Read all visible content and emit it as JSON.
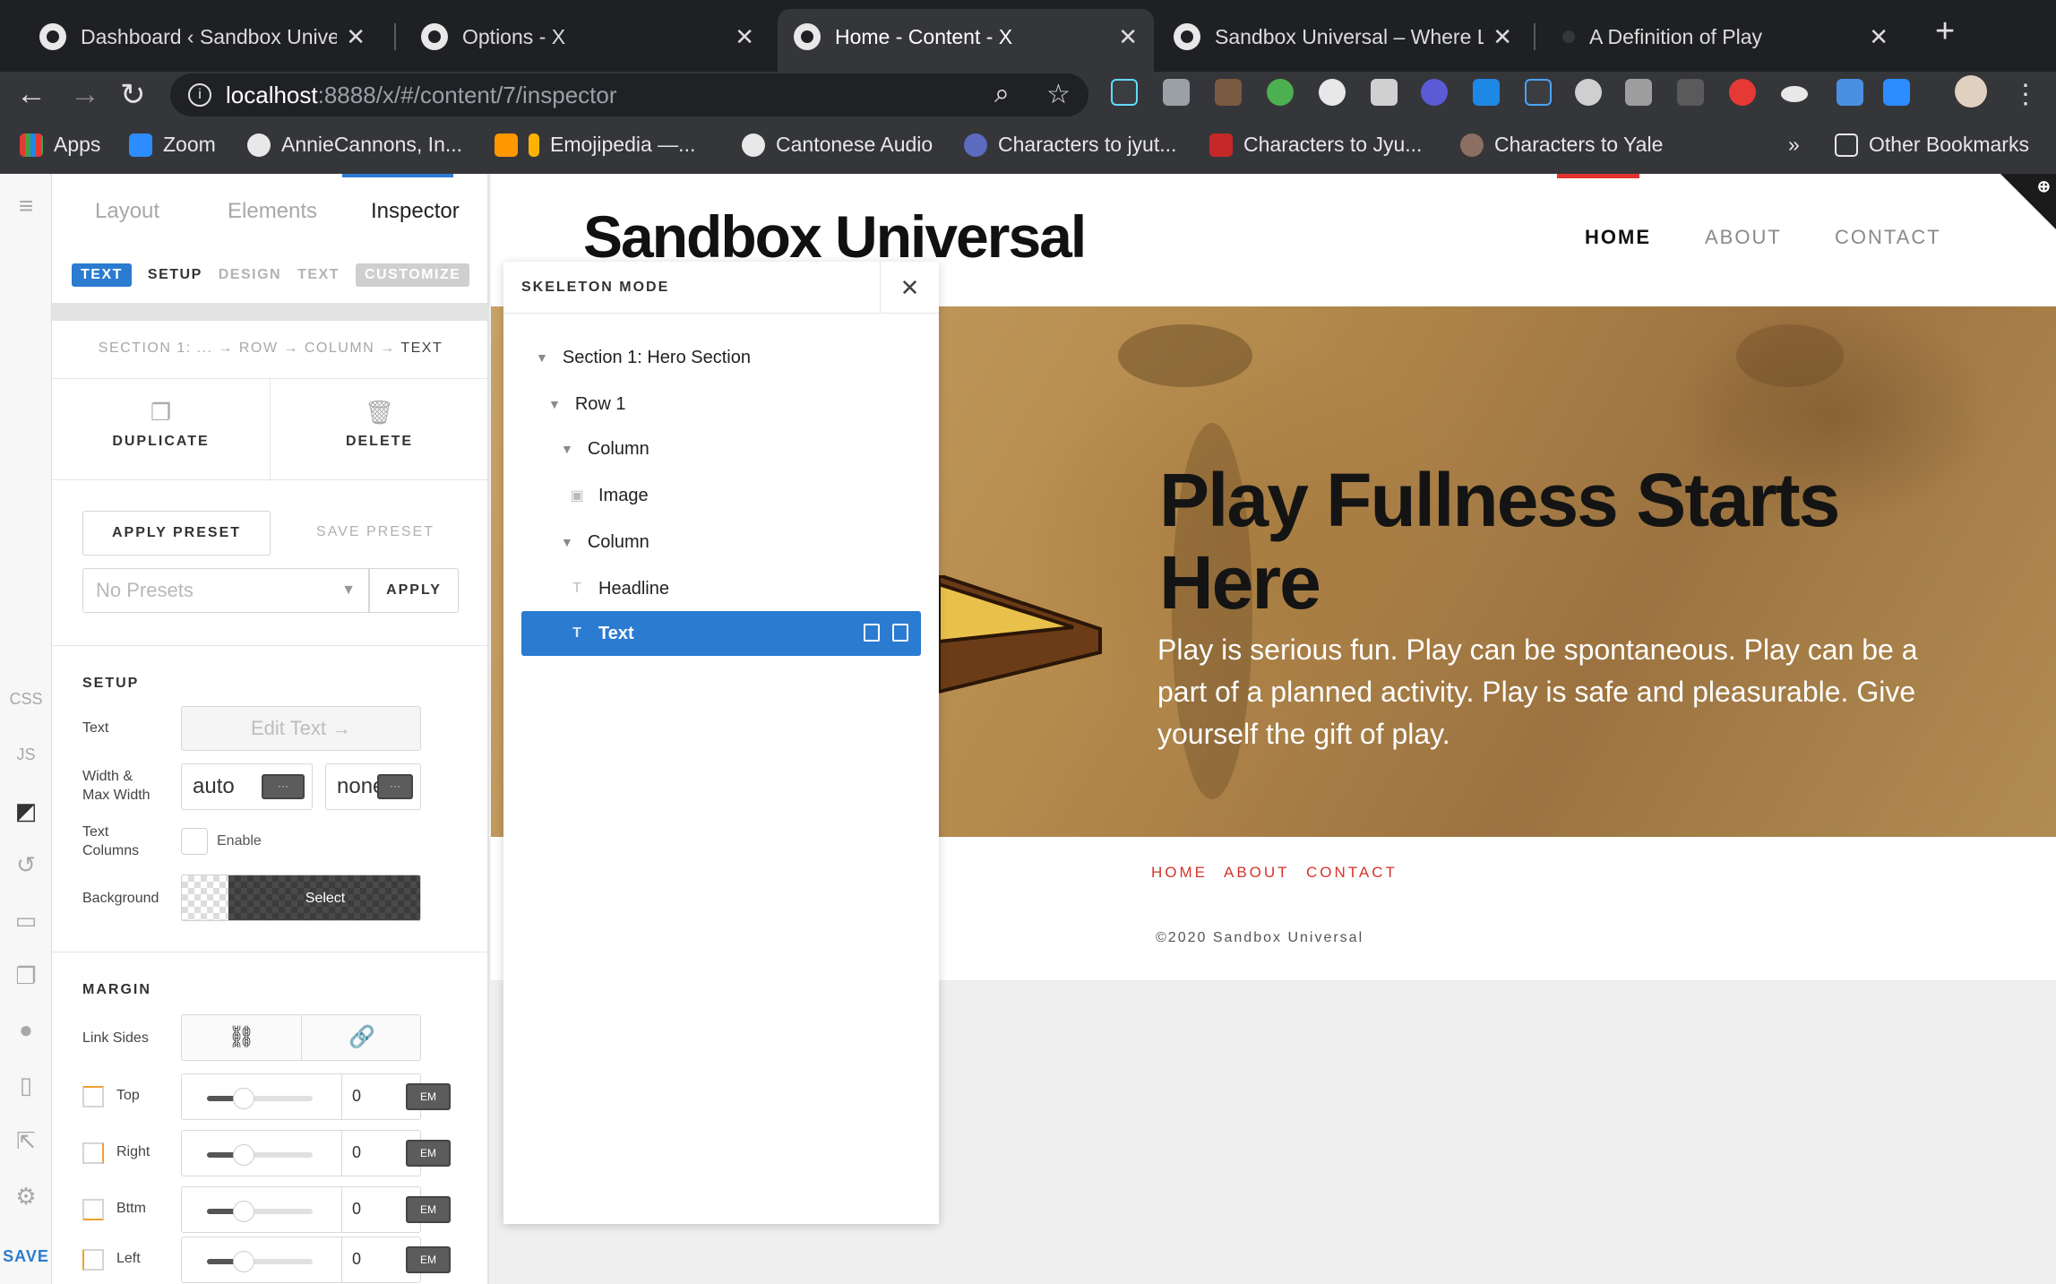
{
  "browser": {
    "tabs": [
      {
        "title": "Dashboard ‹ Sandbox Univers",
        "close": "✕"
      },
      {
        "title": "Options - X",
        "close": "✕"
      },
      {
        "title": "Home - Content - X",
        "close": "✕"
      },
      {
        "title": "Sandbox Universal – Where Lit",
        "close": "✕"
      },
      {
        "title": "A Definition of Play",
        "close": "✕"
      }
    ],
    "url_host": "localhost",
    "url_path": ":8888/x/#/content/7/inspector",
    "bookmarks": [
      "Apps",
      "Zoom",
      "AnnieCannons, In...",
      "Emojipedia —...",
      "Cantonese Audio",
      "Characters to jyut...",
      "Characters to Jyu...",
      "Characters to Yale"
    ],
    "more_bookmarks": "»",
    "other_bookmarks": "Other Bookmarks"
  },
  "rail": {
    "css": "CSS",
    "js": "JS",
    "save": "SAVE"
  },
  "inspector": {
    "tabs": [
      "Layout",
      "Elements",
      "Inspector"
    ],
    "subtabs": {
      "text_pill": "TEXT",
      "setup": "SETUP",
      "design": "DESIGN",
      "text": "TEXT",
      "customize": "CUSTOMIZE"
    },
    "breadcrumb": {
      "section": "SECTION 1: ...",
      "row": "ROW",
      "column": "COLUMN",
      "text": "TEXT"
    },
    "duplicate": "DUPLICATE",
    "delete": "DELETE",
    "apply_preset": "APPLY PRESET",
    "save_preset": "SAVE PRESET",
    "presets_placeholder": "No Presets",
    "apply": "APPLY",
    "setup": {
      "heading": "SETUP",
      "text_label": "Text",
      "edit_text": "Edit Text →",
      "width_label_1": "Width &",
      "width_label_2": "Max Width",
      "width_value": "auto",
      "max_width_value": "none",
      "mini_btn": "···",
      "columns_label_1": "Text",
      "columns_label_2": "Columns",
      "enable": "Enable",
      "background_label": "Background",
      "background_select": "Select"
    },
    "margin": {
      "heading": "MARGIN",
      "link_sides": "Link Sides",
      "rows": [
        {
          "label": "Top",
          "value": "0",
          "unit": "EM",
          "slider": 0.35
        },
        {
          "label": "Right",
          "value": "0",
          "unit": "EM",
          "slider": 0.35
        },
        {
          "label": "Bttm",
          "value": "0",
          "unit": "EM",
          "slider": 0.35
        },
        {
          "label": "Left",
          "value": "0",
          "unit": "EM",
          "slider": 0.35
        }
      ]
    }
  },
  "site": {
    "logo": "Sandbox Universal",
    "nav": [
      "HOME",
      "ABOUT",
      "CONTACT"
    ],
    "hero_headline": "Play Fullness Starts Here",
    "hero_body": "Play is serious fun. Play can be spontaneous. Play can be a part of a planned activity. Play is safe and pleasurable. Give yourself the gift of play.",
    "footer_nav": [
      "HOME",
      "ABOUT",
      "CONTACT"
    ],
    "copyright": "©2020 Sandbox Universal"
  },
  "skeleton": {
    "title": "SKELETON MODE",
    "close": "✕",
    "tree": [
      {
        "label": "Section 1: Hero Section"
      },
      {
        "label": "Row 1"
      },
      {
        "label": "Column"
      },
      {
        "label": "Image"
      },
      {
        "label": "Column"
      },
      {
        "label": "Headline"
      },
      {
        "label": "Text"
      }
    ]
  },
  "colors": {
    "accent": "#2b7bd0",
    "footer_link": "#d6332b",
    "nav_active_bar": "#e4332c"
  }
}
